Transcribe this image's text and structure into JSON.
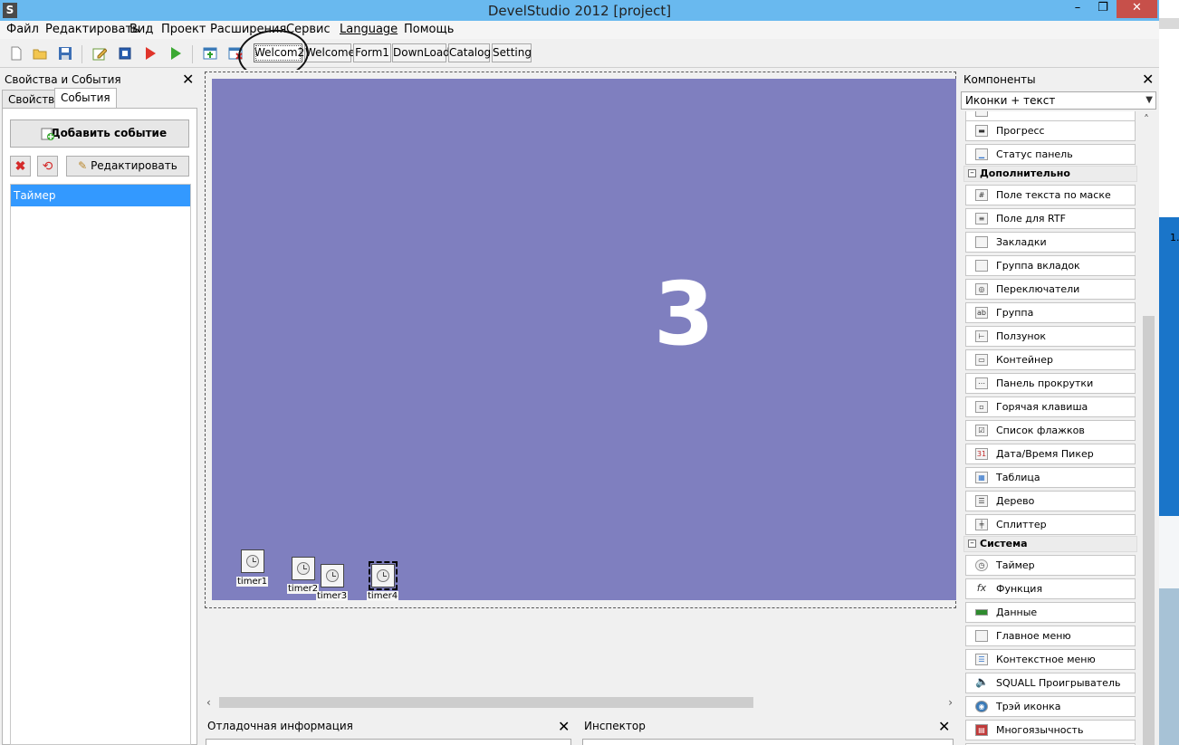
{
  "window": {
    "app_icon_letter": "S",
    "title": "DevelStudio 2012 [project]",
    "minimize": "–",
    "maximize": "❐",
    "close": "✕"
  },
  "menu": [
    "Файл",
    "Редактировать",
    "Вид",
    "Проект",
    "Расширения",
    "Сервис",
    "Language",
    "Помощь"
  ],
  "toolbar": {
    "form_tabs": [
      "Welcom2",
      "Welcome",
      "Form1",
      "DownLoad",
      "Catalog",
      "Setting"
    ],
    "active_tab": "Welcom2"
  },
  "left_panel": {
    "title": "Свойства и События",
    "close": "✕",
    "tabs": [
      "Свойства",
      "События"
    ],
    "active_tab": "События",
    "add_event_label": "Добавить событие",
    "edit_label": "Редактировать",
    "events": [
      "Таймер"
    ]
  },
  "design": {
    "big_number": "3",
    "form_bg": "#7f7fbf",
    "timers": [
      "timer1",
      "timer2",
      "timer3",
      "timer4"
    ],
    "selected_timer": "timer4"
  },
  "bottom": {
    "debug_title": "Отладочная информация",
    "inspector_title": "Инспектор",
    "close": "✕"
  },
  "right_panel": {
    "title": "Компоненты",
    "close": "✕",
    "view_mode": "Иконки + текст",
    "items_top": [
      "Прогресс",
      "Статус панель"
    ],
    "cat_additional": "Дополнительно",
    "items_additional": [
      "Поле текста по маске",
      "Поле для RTF",
      "Закладки",
      "Группа вкладок",
      "Переключатели",
      "Группа",
      "Ползунок",
      "Контейнер",
      "Панель прокрутки",
      "Горячая клавиша",
      "Список флажков",
      "Дата/Время Пикер",
      "Таблица",
      "Дерево",
      "Сплиттер"
    ],
    "cat_system": "Система",
    "items_system": [
      "Таймер",
      "Функция",
      "Данные",
      "Главное меню",
      "Контекстное меню",
      "SQUALL Проигрыватель",
      "Трэй иконка",
      "Многоязычность"
    ]
  },
  "desktop_edge_text": "1."
}
